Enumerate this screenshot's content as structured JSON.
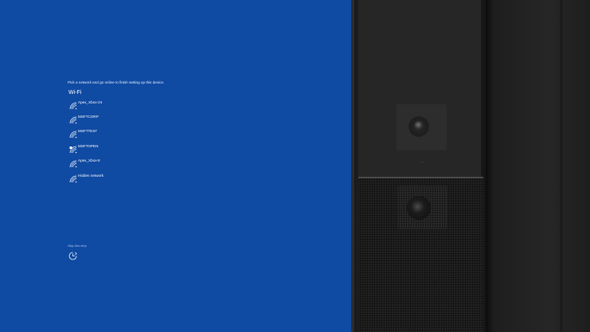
{
  "setup": {
    "prompt": "Pick a network and go online to finish setting up this device.",
    "section_title": "Wi-Fi",
    "networks": [
      {
        "name": "Apex_Xbox-24",
        "secured": false
      },
      {
        "name": "MSFTCORP",
        "secured": false
      },
      {
        "name": "MSFTTEST",
        "secured": false
      },
      {
        "name": "MSFTOPEN",
        "secured": true
      },
      {
        "name": "Apex_Xbox-5",
        "secured": false
      },
      {
        "name": "Hidden network",
        "secured": false
      }
    ],
    "skip_label": "Skip this step",
    "accessibility_icon": "ease-of-access-icon"
  },
  "colors": {
    "screen_background": "#0f4aa3",
    "text": "#ffffff",
    "device_body": "#262627"
  }
}
